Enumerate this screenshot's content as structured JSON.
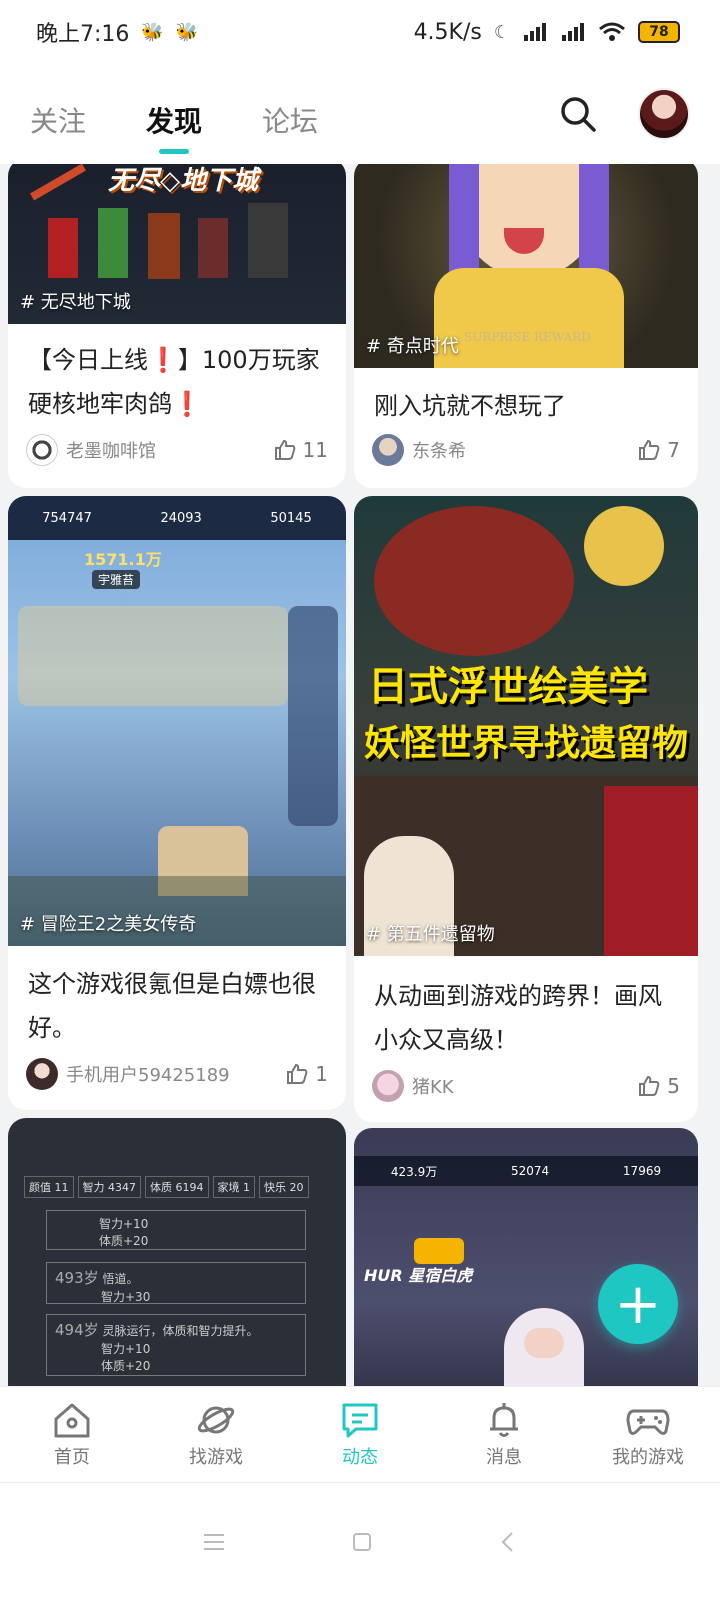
{
  "status_bar": {
    "time": "晚上7:16",
    "speed": "4.5K/s",
    "battery": "78"
  },
  "header": {
    "tabs": [
      {
        "label": "关注",
        "active": false
      },
      {
        "label": "发现",
        "active": true
      },
      {
        "label": "论坛",
        "active": false
      }
    ]
  },
  "feed": {
    "cards": [
      {
        "tag": "# 无尽地下城",
        "banner_text": "无尽◇地下城",
        "title": "【今日上线❗】100万玩家硬核地牢肉鸽❗",
        "author": "老墨咖啡馆",
        "likes": "11"
      },
      {
        "tag": "# 奇点时代",
        "banner_text": "SURPRISE REWARD",
        "title": "刚入坑就不想玩了",
        "author": "东条希",
        "likes": "7"
      },
      {
        "tag": "# 冒险王2之美女传奇",
        "title": "这个游戏很氪但是白嫖也很好。",
        "author": "手机用户59425189",
        "likes": "1",
        "game_ui": {
          "coins": "754747",
          "gems": "24093",
          "tickets": "50145",
          "power": "1571.1万",
          "name": "宇雅苔"
        }
      },
      {
        "tag": "# 第五件遗留物",
        "banner_line1": "日式浮世绘美学",
        "banner_line2": "妖怪世界寻找遗留物",
        "title": "从动画到游戏的跨界！画风小众又高级！",
        "author": "猪KK",
        "likes": "5"
      },
      {
        "game_stats": [
          "颜值 11",
          "智力 4347",
          "体质 6194",
          "家境 1",
          "快乐 20"
        ],
        "entries": [
          {
            "age": "",
            "text": "智力+10",
            "text2": "体质+20"
          },
          {
            "age": "493岁",
            "text": "悟道。",
            "text2": "智力+30"
          },
          {
            "age": "494岁",
            "text": "灵脉运行，体质和智力提升。",
            "text2": "智力+10",
            "text3": "体质+20"
          }
        ]
      },
      {
        "game_ui": {
          "coins": "423.9万",
          "gems": "52074",
          "tickets": "17969",
          "hero": "HUR 星宿白虎"
        }
      }
    ]
  },
  "fab": {
    "label": "+"
  },
  "bottom_nav": {
    "items": [
      {
        "label": "首页",
        "icon": "home-icon"
      },
      {
        "label": "找游戏",
        "icon": "planet-icon"
      },
      {
        "label": "动态",
        "icon": "feed-icon",
        "active": true
      },
      {
        "label": "消息",
        "icon": "bell-icon"
      },
      {
        "label": "我的游戏",
        "icon": "gamepad-icon"
      }
    ]
  },
  "colors": {
    "accent": "#1fc7c3",
    "text": "#222222",
    "muted": "#888888"
  }
}
